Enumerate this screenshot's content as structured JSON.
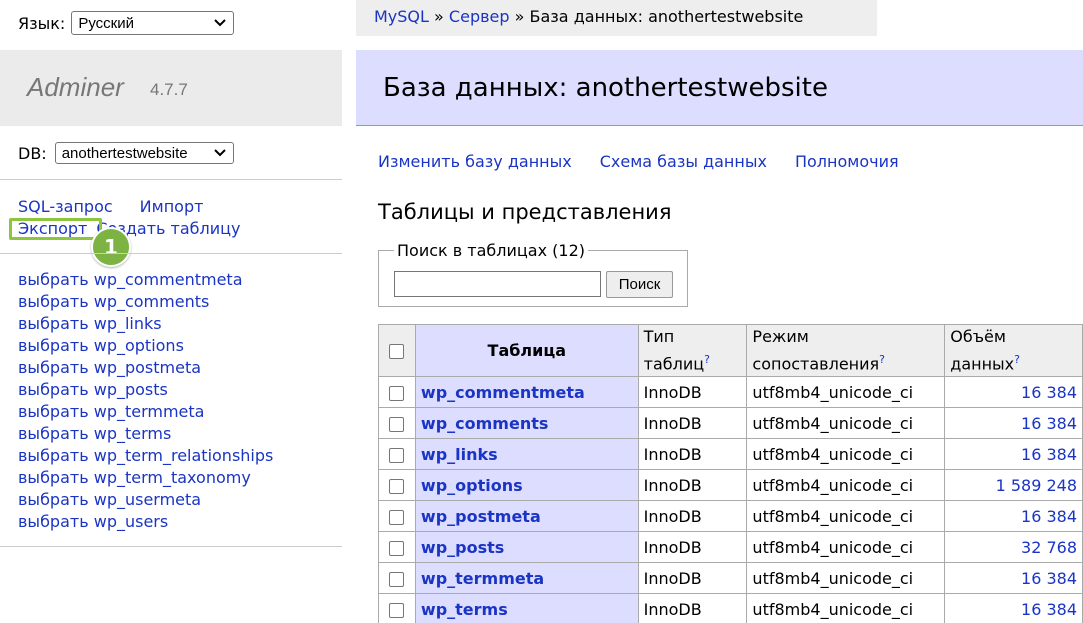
{
  "sidebar": {
    "language_label": "Язык:",
    "language_value": "Русский",
    "brand_name": "Adminer",
    "brand_version": "4.7.7",
    "db_label": "DB:",
    "db_value": "anothertestwebsite",
    "links": {
      "sql": "SQL-запрос",
      "import": "Импорт",
      "export": "Экспорт",
      "create_table": "Создать таблицу"
    },
    "badge": "1",
    "tables": [
      "выбрать wp_commentmeta",
      "выбрать wp_comments",
      "выбрать wp_links",
      "выбрать wp_options",
      "выбрать wp_postmeta",
      "выбрать wp_posts",
      "выбрать wp_termmeta",
      "выбрать wp_terms",
      "выбрать wp_term_relationships",
      "выбрать wp_term_taxonomy",
      "выбрать wp_usermeta",
      "выбрать wp_users"
    ]
  },
  "breadcrumb": {
    "mysql": "MySQL",
    "sep1": "»",
    "server": "Сервер",
    "sep2": "»",
    "current": "База данных: anothertestwebsite"
  },
  "main": {
    "title": "База данных: anothertestwebsite",
    "actions": {
      "alter_db": "Изменить базу данных",
      "schema": "Схема базы данных",
      "privileges": "Полномочия"
    },
    "section_title": "Таблицы и представления",
    "search": {
      "legend": "Поиск в таблицах (12)",
      "button": "Поиск",
      "value": ""
    },
    "table": {
      "headers": {
        "name": "Таблица",
        "engine_line1": "Тип",
        "engine_line2": "таблиц",
        "collation_line1": "Режим",
        "collation_line2": "сопоставления",
        "size_line1": "Объём",
        "size_line2": "данных",
        "help": "?"
      },
      "rows": [
        {
          "name": "wp_commentmeta",
          "engine": "InnoDB",
          "collation": "utf8mb4_unicode_ci",
          "size": "16 384"
        },
        {
          "name": "wp_comments",
          "engine": "InnoDB",
          "collation": "utf8mb4_unicode_ci",
          "size": "16 384"
        },
        {
          "name": "wp_links",
          "engine": "InnoDB",
          "collation": "utf8mb4_unicode_ci",
          "size": "16 384"
        },
        {
          "name": "wp_options",
          "engine": "InnoDB",
          "collation": "utf8mb4_unicode_ci",
          "size": "1 589 248"
        },
        {
          "name": "wp_postmeta",
          "engine": "InnoDB",
          "collation": "utf8mb4_unicode_ci",
          "size": "16 384"
        },
        {
          "name": "wp_posts",
          "engine": "InnoDB",
          "collation": "utf8mb4_unicode_ci",
          "size": "32 768"
        },
        {
          "name": "wp_termmeta",
          "engine": "InnoDB",
          "collation": "utf8mb4_unicode_ci",
          "size": "16 384"
        },
        {
          "name": "wp_terms",
          "engine": "InnoDB",
          "collation": "utf8mb4_unicode_ci",
          "size": "16 384"
        }
      ]
    }
  },
  "colors": {
    "link": "#1a34c4",
    "header_bg": "#ddddff",
    "highlight": "#8cc63f",
    "badge": "#7cb342"
  }
}
